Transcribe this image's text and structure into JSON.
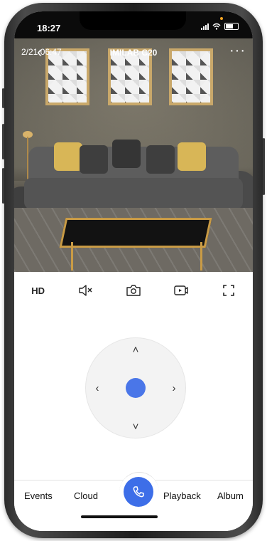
{
  "status_bar": {
    "time": "18:27"
  },
  "video": {
    "timestamp": "2/21 06:47",
    "device_name": "IMILAB C20",
    "more_label": "···",
    "back_label": "‹"
  },
  "toolbar": {
    "hd_label": "HD",
    "icons": [
      "mute-icon",
      "camera-snapshot-icon",
      "video-record-icon",
      "fullscreen-icon"
    ]
  },
  "ptz": {
    "up": "˄",
    "down": "˅",
    "left": "‹",
    "right": "›"
  },
  "bottom_nav": {
    "events": "Events",
    "cloud": "Cloud",
    "playback": "Playback",
    "album": "Album",
    "call_icon": "phone-icon"
  },
  "colors": {
    "accent": "#3d6ee8",
    "dpad_center": "#4a76e8"
  }
}
